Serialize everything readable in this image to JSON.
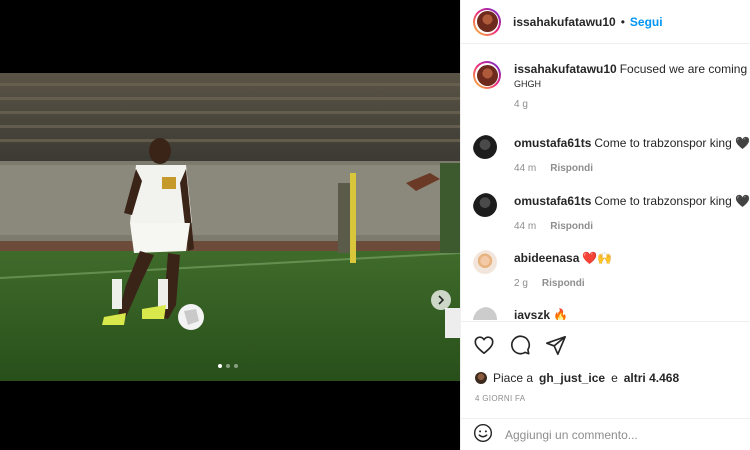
{
  "post": {
    "author": "issahakufatawu10",
    "separator": "•",
    "follow_label": "Segui",
    "caption_author": "issahakufatawu10",
    "caption_text": "Focused we are coming back",
    "caption_sub": "GHGH",
    "caption_age": "4 g",
    "media_dots": 3,
    "active_dot": 0
  },
  "comments": [
    {
      "user": "omustafa61ts",
      "text": "Come to trabzonspor king 🖤💙",
      "age": "44 m",
      "reply": "Rispondi"
    },
    {
      "user": "omustafa61ts",
      "text": "Come to trabzonspor king 🖤💙",
      "age": "44 m",
      "reply": "Rispondi"
    },
    {
      "user": "abideenasa",
      "text": "❤️🙌",
      "age": "2 g",
      "reply": "Rispondi"
    },
    {
      "user": "iavszk",
      "text": "🔥",
      "age": "",
      "reply": ""
    }
  ],
  "likes": {
    "prefix": "Piace a",
    "user": "gh_just_ice",
    "middle": "e",
    "count": "altri 4.468"
  },
  "date_label": "4 GIORNI FA",
  "add_comment": {
    "placeholder": "Aggiungi un commento..."
  },
  "icons": {
    "like": "heart-icon",
    "comment": "comment-icon",
    "share": "share-icon",
    "emoji": "emoji-icon",
    "next": "chevron-right-icon"
  },
  "colors": {
    "accent": "#0095f6",
    "text": "#262626",
    "muted": "#8e8e8e"
  }
}
